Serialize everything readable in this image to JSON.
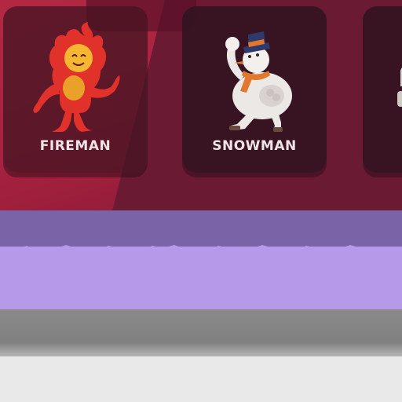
{
  "characters": [
    {
      "name": "FIREMAN",
      "icon": "fireman-icon"
    },
    {
      "name": "SNOWMAN",
      "icon": "snowman-icon"
    },
    {
      "name": "",
      "icon": "partial-character-icon"
    }
  ],
  "colors": {
    "scene_background": "#6b1a33",
    "card_background": "#2d1420",
    "label_text": "#f0e4e6",
    "band_purple_dark": "#7b63a7",
    "band_purple_light": "#b69ae9",
    "band_grey": "#808080",
    "band_white": "#e9e9e9"
  }
}
